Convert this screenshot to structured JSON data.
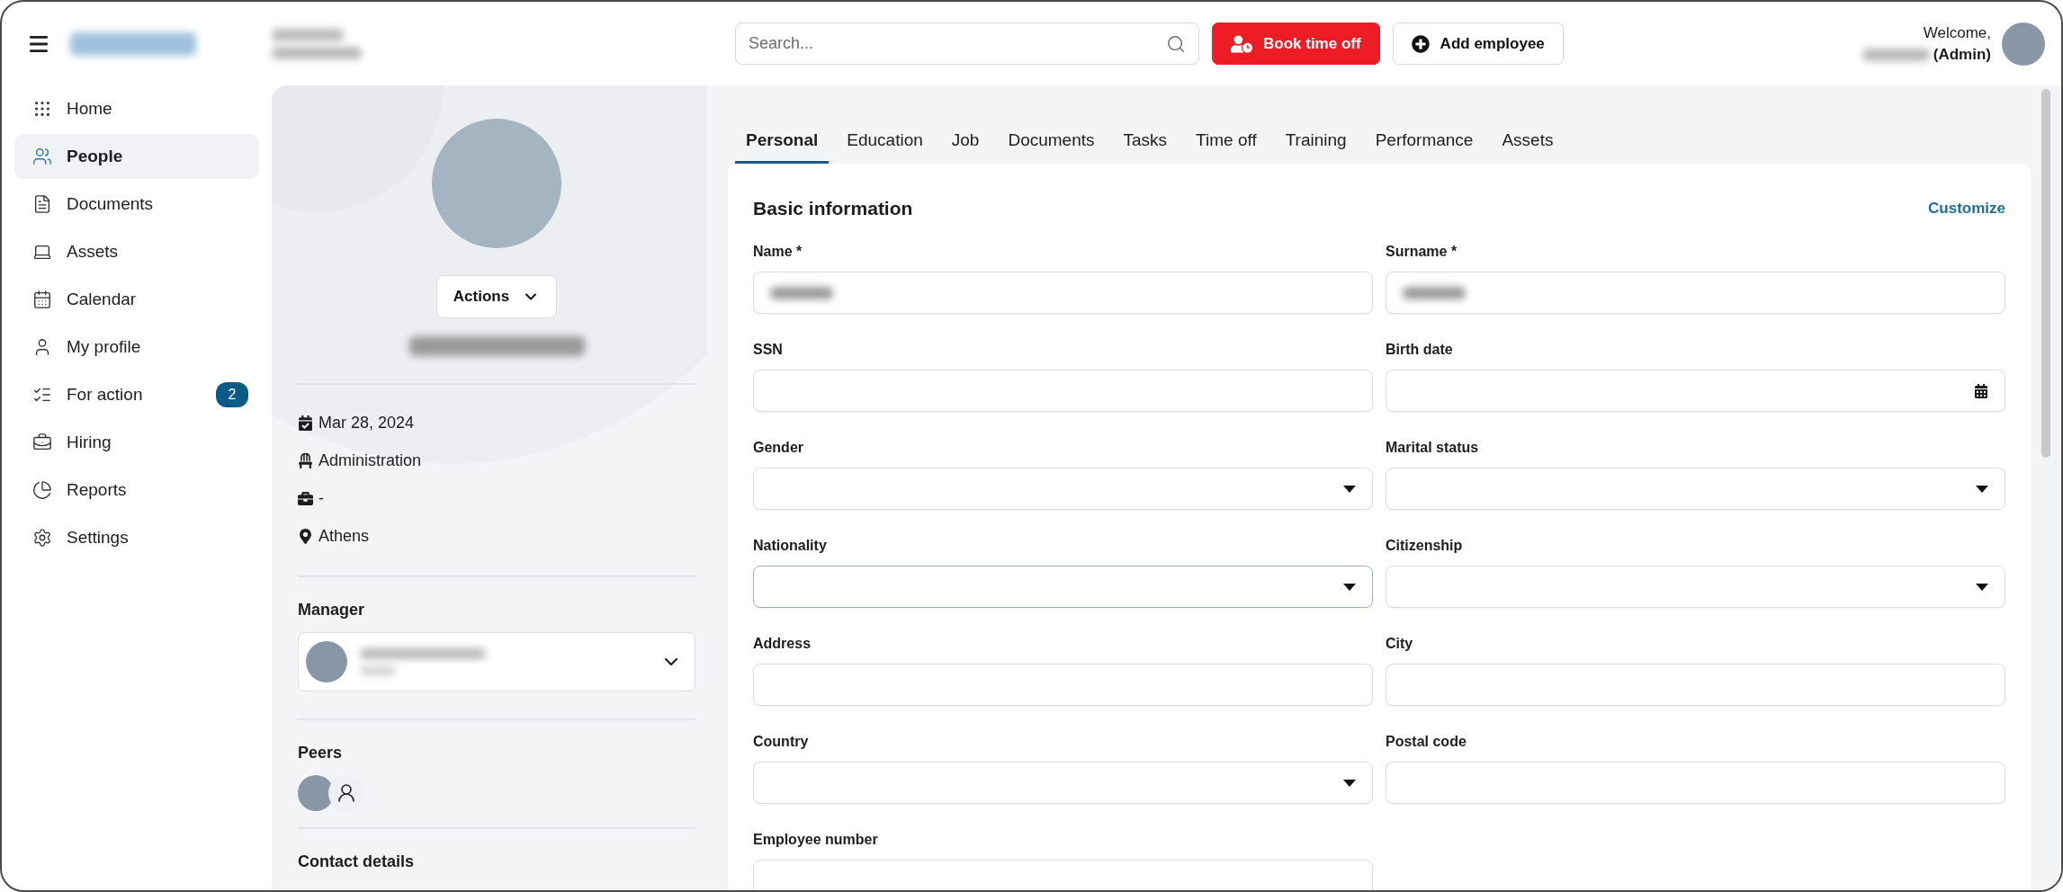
{
  "topbar": {
    "search": {
      "placeholder": "Search..."
    },
    "buttons": [
      {
        "label": "Book time off",
        "kind": "primary"
      },
      {
        "label": "Add employee",
        "kind": "secondary"
      }
    ],
    "welcome": "Welcome,",
    "role": "(Admin)"
  },
  "sidebar": {
    "items": [
      {
        "label": "Home",
        "selected": false
      },
      {
        "label": "People",
        "selected": true
      },
      {
        "label": "Documents",
        "selected": false
      },
      {
        "label": "Assets",
        "selected": false
      },
      {
        "label": "Calendar",
        "selected": false
      },
      {
        "label": "My profile",
        "selected": false
      },
      {
        "label": "For action",
        "selected": false,
        "badge": "2"
      },
      {
        "label": "Hiring",
        "selected": false
      },
      {
        "label": "Reports",
        "selected": false
      },
      {
        "label": "Settings",
        "selected": false
      }
    ]
  },
  "profile": {
    "actions": "Actions",
    "details": [
      "Mar 28, 2024",
      "Administration",
      "-",
      "Athens"
    ],
    "manager_label": "Manager",
    "peers_label": "Peers",
    "contact_label": "Contact details"
  },
  "tabs": [
    {
      "label": "Personal",
      "selected": true
    },
    {
      "label": "Education",
      "selected": false
    },
    {
      "label": "Job",
      "selected": false
    },
    {
      "label": "Documents",
      "selected": false
    },
    {
      "label": "Tasks",
      "selected": false
    },
    {
      "label": "Time off",
      "selected": false
    },
    {
      "label": "Training",
      "selected": false
    },
    {
      "label": "Performance",
      "selected": false
    },
    {
      "label": "Assets",
      "selected": false
    }
  ],
  "form": {
    "title": "Basic information",
    "customize": "Customize",
    "fields": [
      {
        "label": "Name *",
        "kind": "text",
        "filled": true,
        "focused": false
      },
      {
        "label": "Surname *",
        "kind": "text",
        "filled": true,
        "focused": false
      },
      {
        "label": "SSN",
        "kind": "text",
        "filled": false,
        "focused": false
      },
      {
        "label": "Birth date",
        "kind": "date",
        "filled": false,
        "focused": false
      },
      {
        "label": "Gender",
        "kind": "select",
        "filled": false,
        "focused": false
      },
      {
        "label": "Marital status",
        "kind": "select",
        "filled": false,
        "focused": false
      },
      {
        "label": "Nationality",
        "kind": "select",
        "filled": false,
        "focused": true
      },
      {
        "label": "Citizenship",
        "kind": "select",
        "filled": false,
        "focused": false
      },
      {
        "label": "Address",
        "kind": "text",
        "filled": false,
        "focused": false
      },
      {
        "label": "City",
        "kind": "text",
        "filled": false,
        "focused": false
      },
      {
        "label": "Country",
        "kind": "select",
        "filled": false,
        "focused": false
      },
      {
        "label": "Postal code",
        "kind": "text",
        "filled": false,
        "focused": false
      },
      {
        "label": "Employee number",
        "kind": "text",
        "filled": false,
        "focused": false
      }
    ]
  }
}
